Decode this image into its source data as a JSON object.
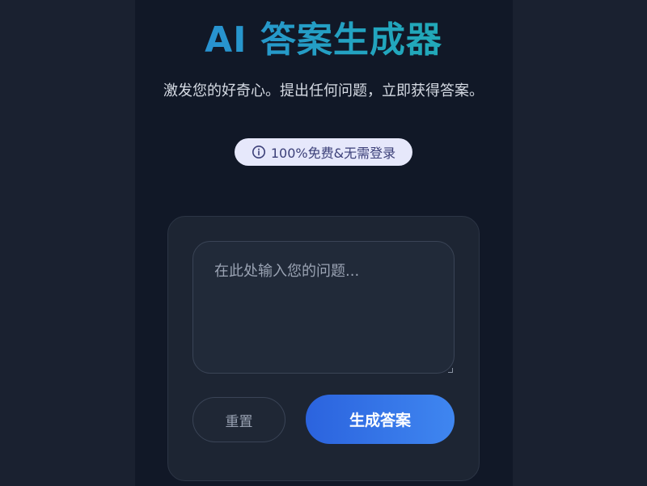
{
  "header": {
    "title": "AI 答案生成器",
    "subtitle": "激发您的好奇心。提出任何问题，立即获得答案。"
  },
  "badge": {
    "icon": "info-icon",
    "text": "100%免费&无需登录"
  },
  "form": {
    "question_value": "",
    "question_placeholder": "在此处输入您的问题...",
    "reset_label": "重置",
    "generate_label": "生成答案"
  },
  "colors": {
    "background": "#1a2130",
    "column": "#111827",
    "card": "#1d2533",
    "accent_start": "#2b63de",
    "accent_end": "#3f86f0",
    "title_gradient_start": "#2f7be6",
    "title_gradient_end": "#1fb3a5",
    "badge_bg": "#e6e8fb",
    "badge_text": "#3b3f78"
  }
}
